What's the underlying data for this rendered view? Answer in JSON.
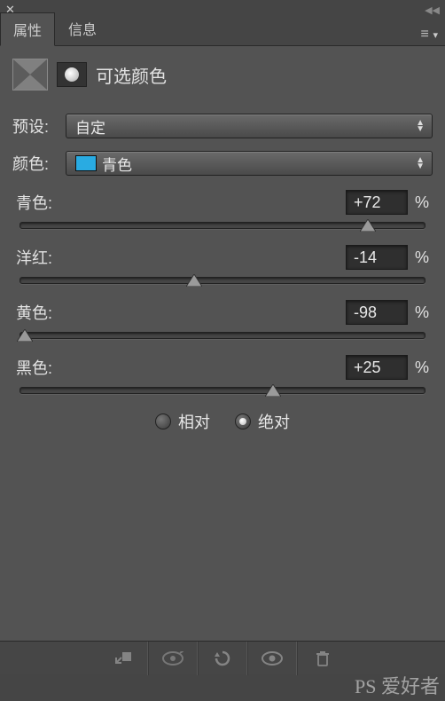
{
  "topbar": {
    "close": "✕",
    "collapse": "◀◀"
  },
  "tabs": {
    "properties": "属性",
    "info": "信息",
    "menu": "▾"
  },
  "header": {
    "title": "可选颜色"
  },
  "preset": {
    "label": "预设:",
    "value": "自定"
  },
  "color": {
    "label": "颜色:",
    "value": "青色",
    "swatch": "#29abe2"
  },
  "sliders": {
    "cyan": {
      "label": "青色:",
      "value": "+72",
      "pct": "%",
      "pos": 86
    },
    "magenta": {
      "label": "洋红:",
      "value": "-14",
      "pct": "%",
      "pos": 43
    },
    "yellow": {
      "label": "黄色:",
      "value": "-98",
      "pct": "%",
      "pos": 1
    },
    "black": {
      "label": "黑色:",
      "value": "+25",
      "pct": "%",
      "pos": 62.5
    }
  },
  "mode": {
    "relative": "相对",
    "absolute": "绝对",
    "selected": "absolute"
  },
  "watermark": "PS 爱好者"
}
